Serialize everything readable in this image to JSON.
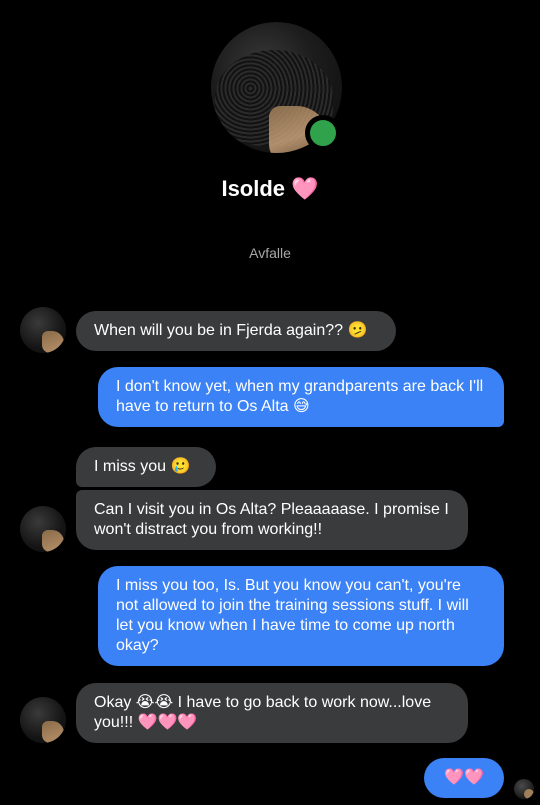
{
  "profile": {
    "name": "Isolde 🩷",
    "subtitle": "Avfalle",
    "online": true
  },
  "messages": [
    {
      "dir": "in",
      "text": "When will you be in Fjerda again?? 🫤"
    },
    {
      "dir": "out",
      "text": "I don't know yet, when my grandparents are back I'll have to return to Os Alta 😅"
    },
    {
      "dir": "in",
      "text": "I miss you 🥲"
    },
    {
      "dir": "in",
      "text": "Can I visit you in Os Alta? Pleaaaaase. I promise I won't distract you from working!!"
    },
    {
      "dir": "out",
      "text": "I miss you too, Is. But you know you can't, you're not allowed to join the training sessions stuff. I will let you know when I have time to come up north okay?"
    },
    {
      "dir": "in",
      "text": "Okay 😭😭 I have to go back to work now...love you!!! 🩷🩷🩷"
    },
    {
      "dir": "out",
      "text": "🩷🩷"
    }
  ],
  "colors": {
    "background": "#000000",
    "incoming_bubble": "#3a3b3c",
    "outgoing_bubble": "#3b82f6",
    "online_indicator": "#31a24c",
    "subtitle_text": "#a8a8a8"
  }
}
